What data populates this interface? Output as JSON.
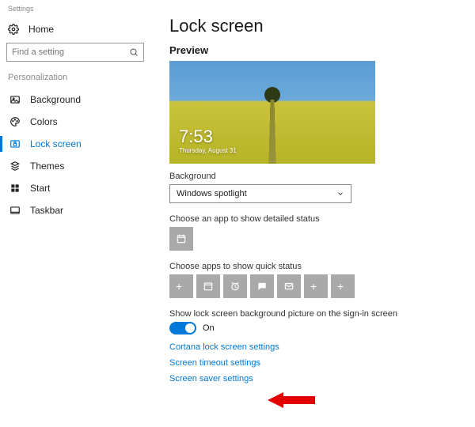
{
  "app_title": "Settings",
  "home_label": "Home",
  "search_placeholder": "Find a setting",
  "section_label": "Personalization",
  "nav": [
    {
      "label": "Background"
    },
    {
      "label": "Colors"
    },
    {
      "label": "Lock screen"
    },
    {
      "label": "Themes"
    },
    {
      "label": "Start"
    },
    {
      "label": "Taskbar"
    }
  ],
  "page_title": "Lock screen",
  "preview_label": "Preview",
  "clock_time": "7:53",
  "clock_date": "Thursday, August 31",
  "background_label": "Background",
  "background_value": "Windows spotlight",
  "detailed_label": "Choose an app to show detailed status",
  "quick_label": "Choose apps to show quick status",
  "signin_label": "Show lock screen background picture on the sign-in screen",
  "toggle_on_label": "On",
  "links": {
    "cortana": "Cortana lock screen settings",
    "timeout": "Screen timeout settings",
    "saver": "Screen saver settings"
  }
}
